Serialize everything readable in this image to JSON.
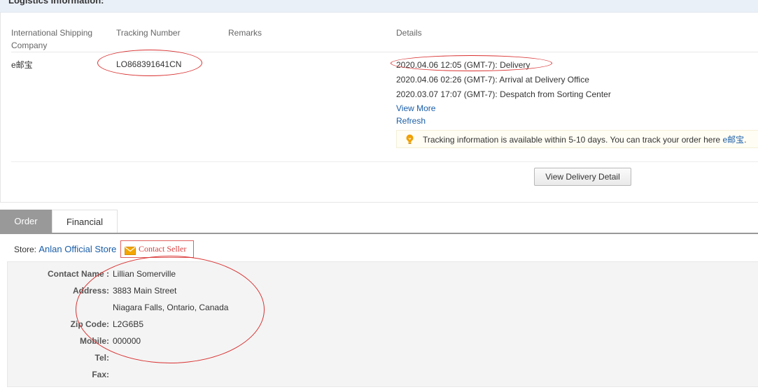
{
  "logistics": {
    "title": "Logistics Information:",
    "headers": {
      "company_line1": "International Shipping",
      "company_line2": "Company",
      "tracking": "Tracking Number",
      "remarks": "Remarks",
      "details": "Details"
    },
    "row": {
      "company": "e邮宝",
      "tracking_number": "LO868391641CN",
      "remarks": "",
      "events": [
        "2020.04.06 12:05 (GMT-7): Delivery",
        "2020.04.06 02:26 (GMT-7): Arrival at Delivery Office",
        "2020.03.07 17:07 (GMT-7): Despatch from Sorting Center"
      ],
      "view_more": "View More",
      "refresh": "Refresh"
    },
    "tip": {
      "text": "Tracking information is available within 5-10 days. You can track your order here ",
      "link": "e邮宝",
      "end": "."
    },
    "view_delivery_detail": "View Delivery Detail"
  },
  "tabs": [
    {
      "label": "Order",
      "active": true
    },
    {
      "label": "Financial",
      "active": false
    }
  ],
  "store": {
    "prefix": "Store: ",
    "name": "Anlan Official Store",
    "contact_seller": "Contact Seller"
  },
  "address": {
    "contact_name_label": "Contact Name :",
    "contact_name": "Lillian Somerville",
    "address_label": "Address:",
    "address_line1": "3883 Main Street",
    "address_line2": "Niagara Falls, Ontario, Canada",
    "zip_label": "Zip Code:",
    "zip": "L2G6B5",
    "mobile_label": "Mobile:",
    "mobile": "000000",
    "tel_label": "Tel:",
    "tel": "",
    "fax_label": "Fax:",
    "fax": ""
  },
  "colors": {
    "link": "#1a5ea8",
    "annotation": "#d93030",
    "active_tab": "#999999",
    "tip_bulb": "#f0a000"
  },
  "icons": {
    "tip": "lightbulb-icon",
    "contact": "envelope-icon"
  }
}
